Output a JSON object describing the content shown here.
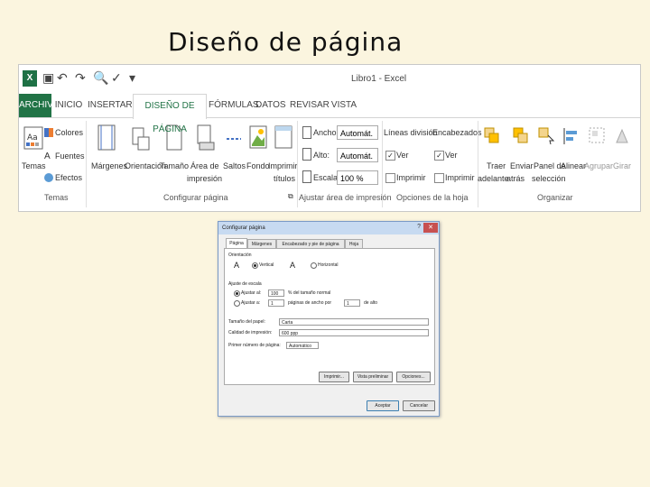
{
  "slide": {
    "title": "Diseño de página"
  },
  "window": {
    "title": "Libro1 - Excel"
  },
  "tabs": {
    "file": "ARCHIVO",
    "home": "INICIO",
    "insert": "INSERTAR",
    "page_layout": "DISEÑO DE PÁGINA",
    "formulas": "FÓRMULAS",
    "data": "DATOS",
    "review": "REVISAR",
    "view": "VISTA"
  },
  "ribbon": {
    "themes": {
      "themes": "Temas",
      "colors": "Colores",
      "fonts": "Fuentes",
      "effects": "Efectos",
      "group": "Temas"
    },
    "page_setup": {
      "margins": "Márgenes",
      "orientation": "Orientación",
      "size": "Tamaño",
      "print_area_1": "Área de",
      "print_area_2": "impresión",
      "breaks": "Saltos",
      "background": "Fondo",
      "print_titles_1": "Imprimir",
      "print_titles_2": "títulos",
      "group": "Configurar página"
    },
    "scale": {
      "width_label": "Ancho:",
      "width_value": "Automát.",
      "height_label": "Alto:",
      "height_value": "Automát.",
      "scale_label": "Escala:",
      "scale_value": "100 %",
      "group": "Ajustar área de impresión"
    },
    "sheet_options": {
      "gridlines": "Líneas división",
      "headings": "Encabezados",
      "view": "Ver",
      "print": "Imprimir",
      "group": "Opciones de la hoja"
    },
    "arrange": {
      "bring_1": "Traer",
      "bring_2": "adelante",
      "send_1": "Enviar",
      "send_2": "atrás",
      "pane_1": "Panel de",
      "pane_2": "selección",
      "align": "Alinear",
      "group_btn": "Agrupar",
      "rotate": "Girar",
      "group": "Organizar"
    }
  },
  "dialog": {
    "title": "Configurar página",
    "tabs": [
      "Página",
      "Márgenes",
      "Encabezado y pie de página",
      "Hoja"
    ],
    "orientation_label": "Orientación",
    "portrait": "Vertical",
    "landscape": "Horizontal",
    "scaling_label": "Ajuste de escala",
    "adjust_to": "Ajustar al:",
    "adjust_value": "100",
    "adjust_suffix": "% del tamaño normal",
    "fit_to": "Ajustar a:",
    "fit_wide": "1",
    "fit_wide_suffix": "páginas de ancho por",
    "fit_tall": "1",
    "fit_tall_suffix": "de alto",
    "paper_size_label": "Tamaño del papel:",
    "paper_size_value": "Carta",
    "print_quality_label": "Calidad de impresión:",
    "print_quality_value": "600 ppp",
    "first_page_label": "Primer número de página:",
    "first_page_value": "Automático",
    "print_btn": "Imprimir...",
    "preview_btn": "Vista preliminar",
    "options_btn": "Opciones...",
    "ok_btn": "Aceptar",
    "cancel_btn": "Cancelar"
  }
}
